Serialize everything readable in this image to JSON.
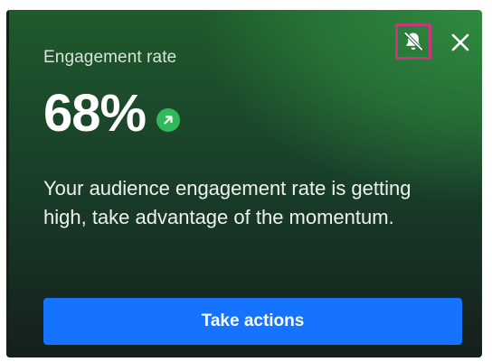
{
  "card": {
    "title": "Engagement rate",
    "metric_value": "68%",
    "trend_icon": "arrow-up-right-icon",
    "description": "Your audience engagement rate is getting high, take advantage of the momentum.",
    "action_label": "Take actions",
    "mute_icon": "bell-off-icon",
    "close_icon": "close-icon"
  },
  "colors": {
    "accent": "#1673ff",
    "trend_badge": "#2fb95a",
    "highlight_outline": "#c8367e",
    "card_gradient_top": "#2f8a3f",
    "card_gradient_bottom": "#151f1c"
  }
}
